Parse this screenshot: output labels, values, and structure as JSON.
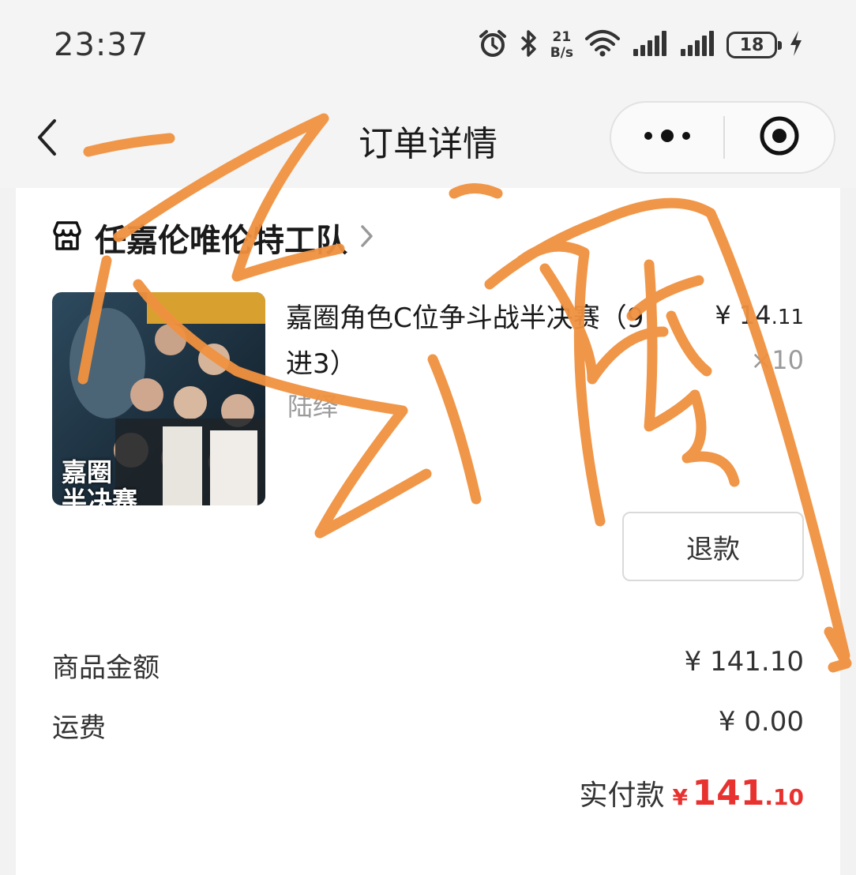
{
  "status_bar": {
    "time": "23:37",
    "net_speed_value": "21",
    "net_speed_unit": "B/s",
    "battery": "18",
    "icons": [
      "alarm-icon",
      "bluetooth-icon",
      "wifi-icon",
      "signal-icon",
      "signal-icon",
      "battery-icon",
      "charging-icon"
    ]
  },
  "nav": {
    "title": "订单详情",
    "back_icon": "chevron-left-icon",
    "more_icon": "more-dots-icon",
    "close_icon": "target-close-icon"
  },
  "shop": {
    "name": "任嘉伦唯伦特工队",
    "icon": "store-icon",
    "chevron_icon": "chevron-right-icon"
  },
  "product": {
    "title": "嘉圈角色C位争斗战半决赛（9进3）",
    "spec": "陆绎",
    "thumb_text_line1": "嘉圈",
    "thumb_text_line2": "半决赛",
    "price_symbol": "¥",
    "price_int": "14",
    "price_dec": ".11",
    "quantity": "×10",
    "refund_label": "退款"
  },
  "summary": {
    "goods_label": "商品金额",
    "goods_value": "¥ 141.10",
    "shipping_label": "运费",
    "shipping_value": "¥ 0.00",
    "paid_label": "实付款",
    "paid_currency": "¥",
    "paid_int": "141",
    "paid_dec": ".10"
  },
  "colors": {
    "accent_red": "#e8322f",
    "scribble_orange": "#f0913f",
    "background": "#f2f2f2"
  }
}
